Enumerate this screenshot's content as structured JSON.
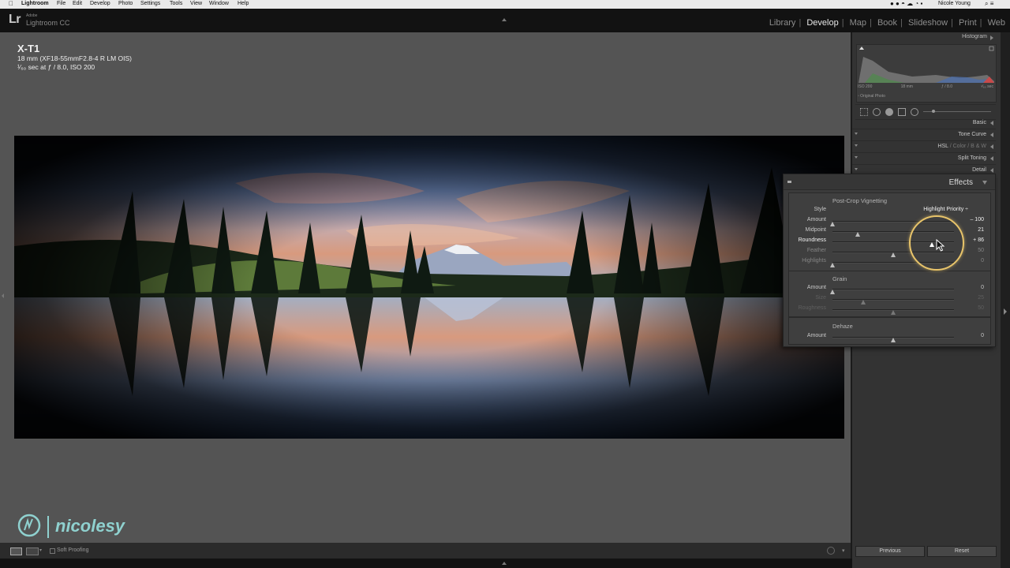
{
  "menubar": {
    "app": "Lightroom",
    "items": [
      "File",
      "Edit",
      "Develop",
      "Photo",
      "Settings",
      "Tools",
      "View",
      "Window",
      "Help"
    ],
    "user": "Nicole Young"
  },
  "lrbar": {
    "logo": "Lr",
    "adobe": "Adobe",
    "app_name": "Lightroom CC",
    "modules": [
      "Library",
      "Develop",
      "Map",
      "Book",
      "Slideshow",
      "Print",
      "Web"
    ],
    "active_module": "Develop"
  },
  "info": {
    "camera": "X-T1",
    "lens": "18 mm (XF18-55mmF2.8-4 R LM OIS)",
    "exposure": "¹⁄₆₀ sec at ƒ / 8.0, ISO 200"
  },
  "watermark": {
    "text": "nicolesy"
  },
  "toolbar": {
    "soft_proofing": "Soft Proofing"
  },
  "right_panel": {
    "histogram_label": "Histogram",
    "hist_stats": [
      "ISO 200",
      "18 mm",
      "ƒ / 8.0",
      "¹⁄₆₀ sec"
    ],
    "original_photo": "Original Photo",
    "panels": [
      {
        "label": "Basic"
      },
      {
        "label": "Tone Curve"
      },
      {
        "label": "HSL",
        "extra": " / Color / B & W"
      },
      {
        "label": "Split Toning"
      },
      {
        "label": "Detail"
      }
    ],
    "previous_label": "Previous",
    "reset_label": "Reset"
  },
  "effects": {
    "title": "Effects",
    "vignetting": {
      "title": "Post-Crop Vignetting",
      "style_label": "Style",
      "style_value": "Highlight Priority ÷",
      "sliders": [
        {
          "label": "Amount",
          "value": "– 100",
          "pos": 0.0
        },
        {
          "label": "Midpoint",
          "value": "21",
          "pos": 0.21
        },
        {
          "label": "Roundness",
          "value": "+ 86",
          "pos": 0.82
        },
        {
          "label": "Feather",
          "value": "50",
          "pos": 0.5
        },
        {
          "label": "Highlights",
          "value": "0",
          "pos": 0.0
        }
      ]
    },
    "grain": {
      "title": "Grain",
      "sliders": [
        {
          "label": "Amount",
          "value": "0",
          "pos": 0.0
        },
        {
          "label": "Size",
          "value": "25",
          "pos": 0.25
        },
        {
          "label": "Roughness",
          "value": "50",
          "pos": 0.5
        }
      ]
    },
    "dehaze": {
      "title": "Dehaze",
      "sliders": [
        {
          "label": "Amount",
          "value": "0",
          "pos": 0.5
        }
      ]
    }
  }
}
